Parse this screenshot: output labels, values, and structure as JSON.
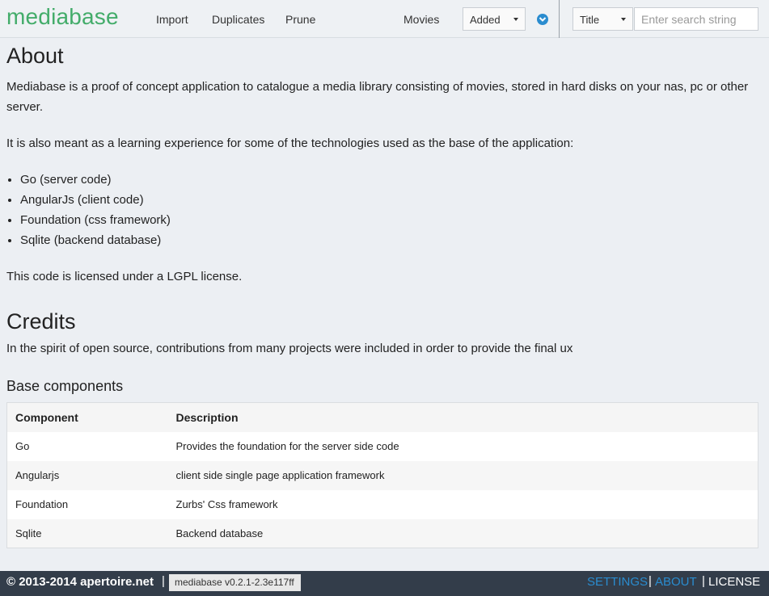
{
  "header": {
    "logo": "mediabase",
    "nav": {
      "import": "Import",
      "duplicates": "Duplicates",
      "prune": "Prune",
      "movies": "Movies"
    },
    "sort_select": "Added",
    "field_select": "Title",
    "search_placeholder": "Enter search string"
  },
  "about": {
    "title": "About",
    "intro": "Mediabase is a proof of concept application to catalogue a media library consisting of movies, stored in hard disks on your nas, pc or other server.",
    "learning": "It is also meant as a learning experience for some of the technologies used as the base of the application:",
    "items": [
      "Go (server code)",
      "AngularJs (client code)",
      "Foundation (css framework)",
      "Sqlite (backend database)"
    ],
    "license": "This code is licensed under a LGPL license."
  },
  "credits": {
    "title": "Credits",
    "intro": "In the spirit of open source, contributions from many projects were included in order to provide the final ux",
    "base_title": "Base components",
    "table": {
      "headers": [
        "Component",
        "Description"
      ],
      "rows": [
        [
          "Go",
          "Provides the foundation for the server side code"
        ],
        [
          "Angularjs",
          "client side single page application framework"
        ],
        [
          "Foundation",
          "Zurbs' Css framework"
        ],
        [
          "Sqlite",
          "Backend database"
        ]
      ]
    }
  },
  "footer": {
    "copyright": "© 2013-2014 apertoire.net",
    "separator": "|",
    "version": "mediabase v0.2.1-2.3e117ff",
    "settings": "SETTINGS",
    "about": "ABOUT",
    "license": "LICENSE"
  },
  "colors": {
    "brand": "#43ac6a",
    "footer_bg": "#333d4a",
    "link_active": "#2a8ccf"
  }
}
